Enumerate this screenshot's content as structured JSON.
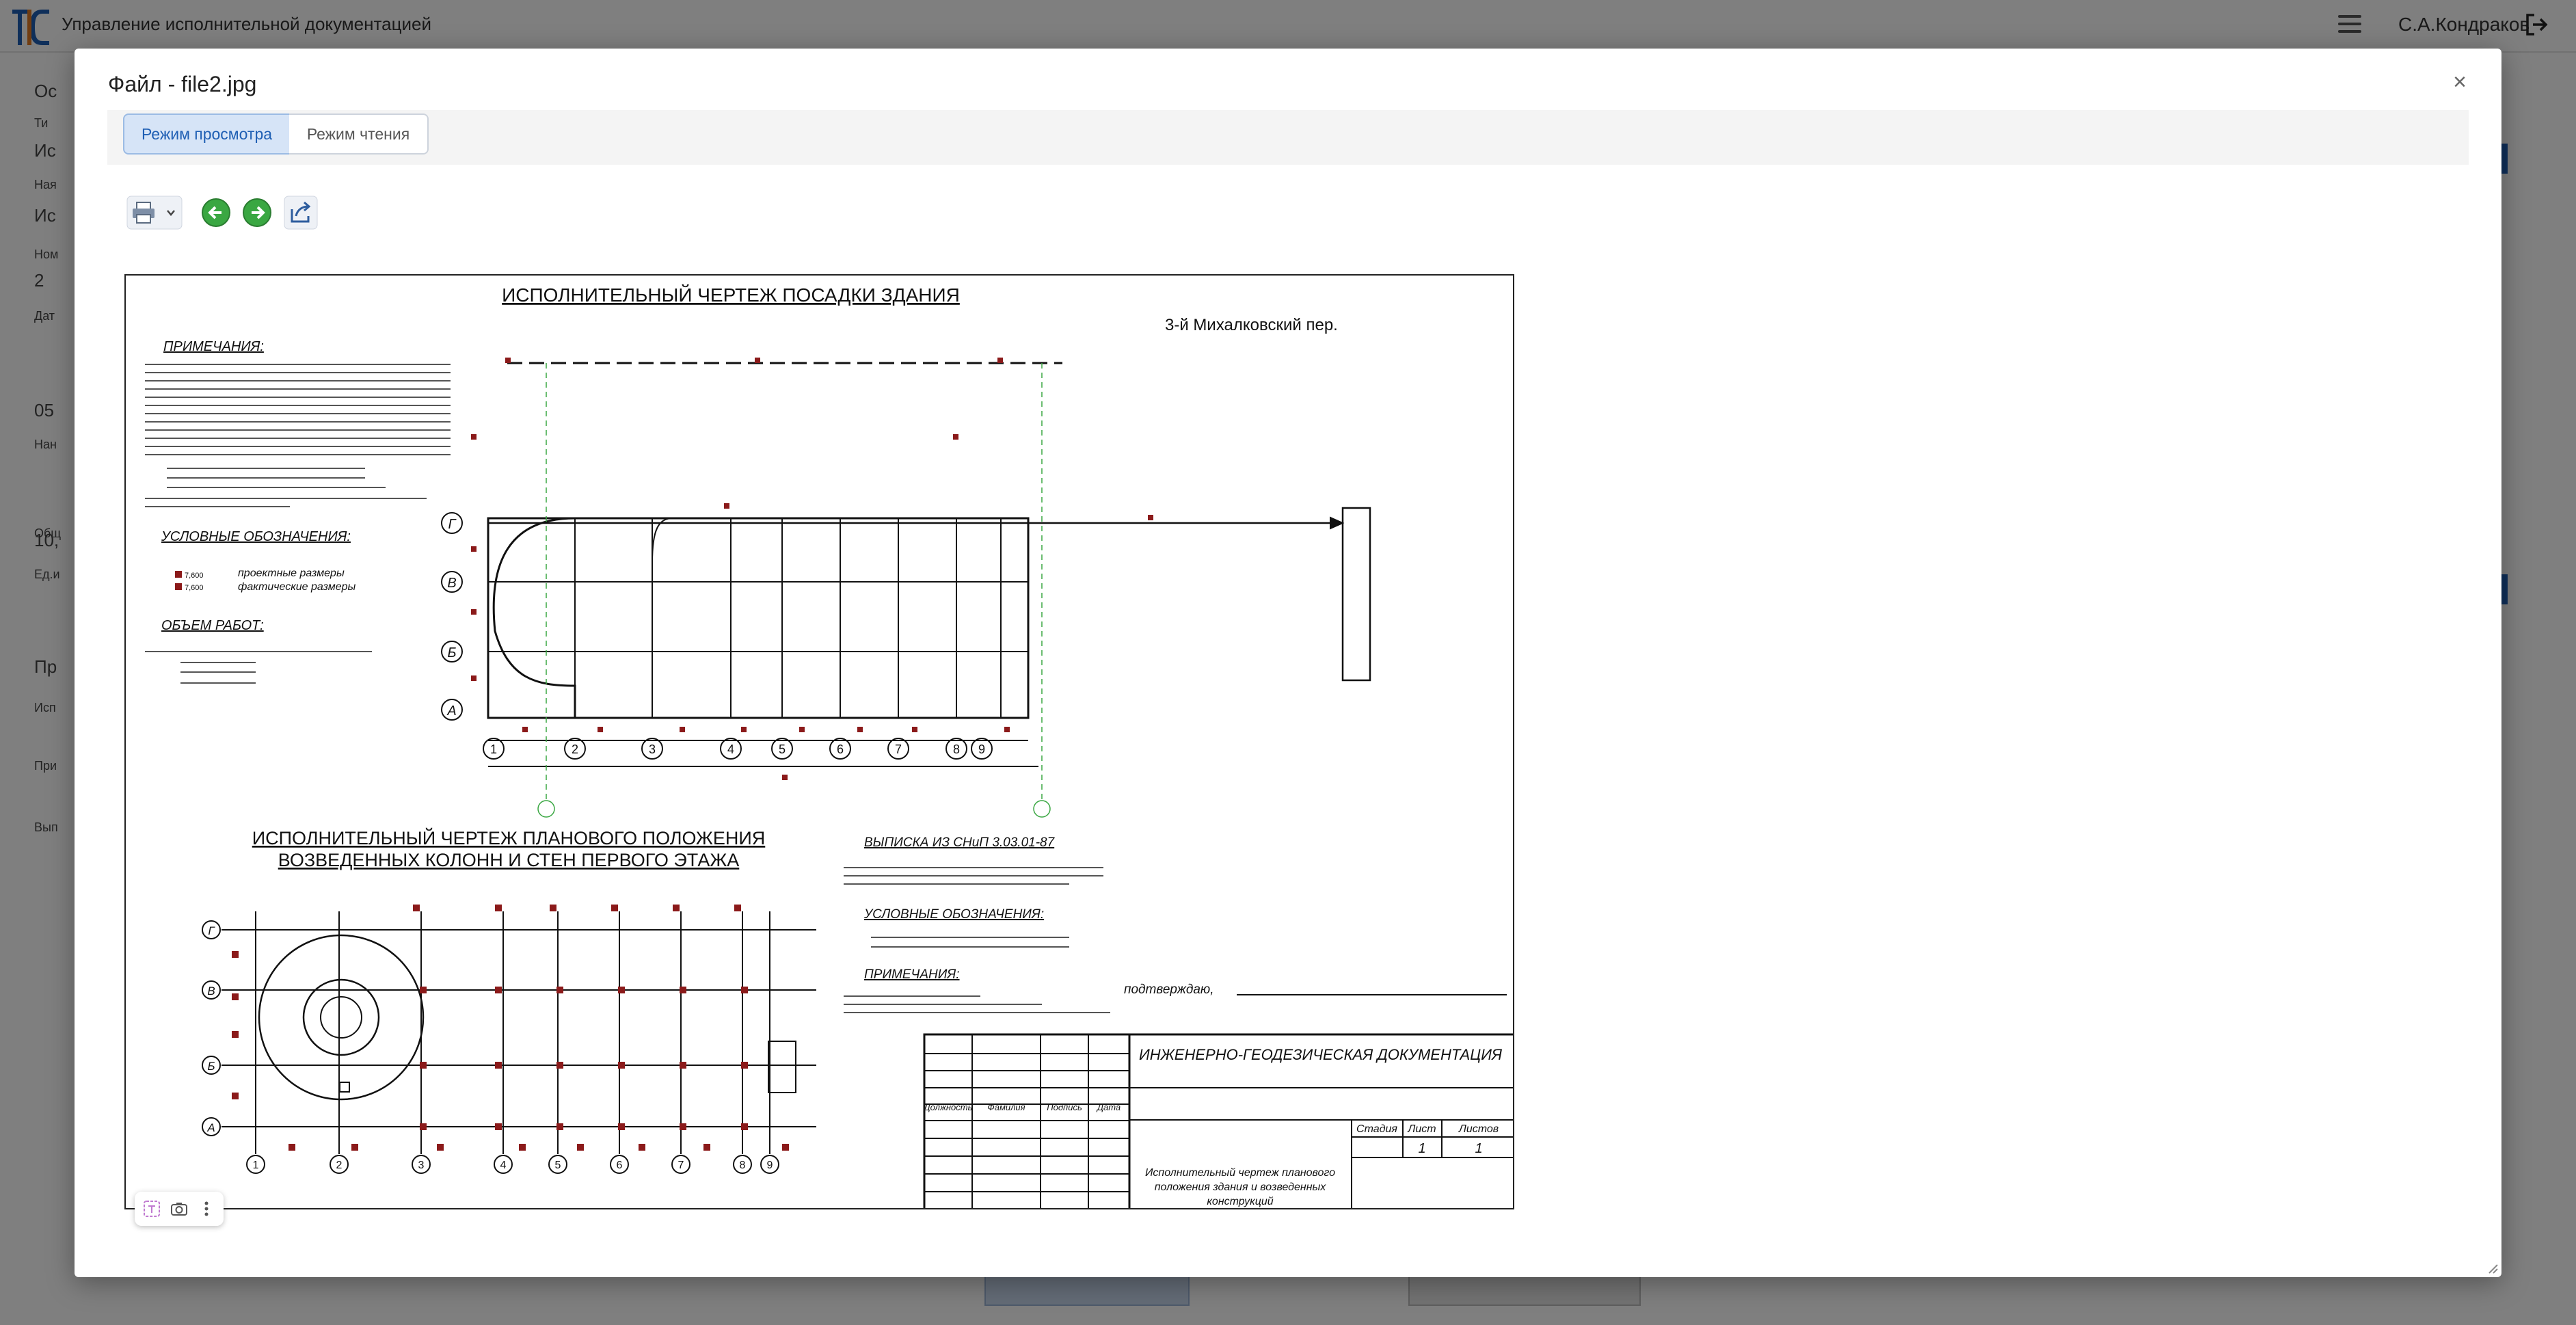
{
  "app": {
    "title": "Управление исполнительной документацией",
    "user_name": "С.А.Кондраков"
  },
  "background_fields": [
    {
      "label": "Ос",
      "value": "Ти"
    },
    {
      "label": "Ис",
      "value": "Ная"
    },
    {
      "label": "Ис",
      "value": "Ном"
    },
    {
      "label": "2",
      "value": "Дат"
    },
    {
      "label": "05",
      "value": "Нан"
    },
    {
      "label": "Общ",
      "value": "10,"
    },
    {
      "label": "Ед.и",
      "value": "Пр"
    },
    {
      "label": "Исп",
      "value": "При"
    },
    {
      "label": "Вып",
      "value": ""
    }
  ],
  "modal": {
    "title": "Файл - file2.jpg",
    "close_label": "×",
    "tabs": [
      {
        "label": "Режим просмотра",
        "active": true
      },
      {
        "label": "Режим чтения",
        "active": false
      }
    ]
  },
  "toolbar": {
    "print": "printer-icon",
    "prev": "arrow-left-icon",
    "next": "arrow-right-icon",
    "share": "share-icon"
  },
  "drawing": {
    "main_title": "ИСПОЛНИТЕЛЬНЫЙ ЧЕРТЕЖ ПОСАДКИ ЗДАНИЯ",
    "street": "3-й Михалковский пер.",
    "notes_title": "ПРИМЕЧАНИЯ:",
    "legend_title": "УСЛОВНЫЕ ОБОЗНАЧЕНИЯ:",
    "legend_design": "проектные размеры",
    "legend_actual": "фактические размеры",
    "legend_val_1": "7,600",
    "legend_val_2": "7,600",
    "volume_title": "ОБЪЕМ РАБОТ:",
    "axes_letters": [
      "Г",
      "В",
      "Б",
      "А"
    ],
    "axes_numbers": [
      "1",
      "2",
      "3",
      "4",
      "5",
      "6",
      "7",
      "8",
      "9"
    ],
    "second_title_1": "ИСПОЛНИТЕЛЬНЫЙ ЧЕРТЕЖ ПЛАНОВОГО ПОЛОЖЕНИЯ",
    "second_title_2": "ВОЗВЕДЕННЫХ КОЛОНН И СТЕН ПЕРВОГО ЭТАЖА",
    "snip_title": "ВЫПИСКА ИЗ СНиП 3.03.01-87",
    "legend2_title": "УСЛОВНЫЕ ОБОЗНАЧЕНИЯ:",
    "notes2_title": "ПРИМЕЧАНИЯ:",
    "approve": "подтверждаю,",
    "stamp_header": "ИНЖЕНЕРНО-ГЕОДЕЗИЧЕСКАЯ ДОКУМЕНТАЦИЯ",
    "stamp_cols": [
      "Должность",
      "Фамилия",
      "Подпись",
      "Дата"
    ],
    "stamp_stage": "Стадия",
    "stamp_sheet": "Лист",
    "stamp_sheets": "Листов",
    "stamp_sheet_val": "1",
    "stamp_sheets_val": "1",
    "stamp_desc_1": "Исполнительный чертеж планового",
    "stamp_desc_2": "положения здания и возведенных",
    "stamp_desc_3": "конструкций"
  }
}
